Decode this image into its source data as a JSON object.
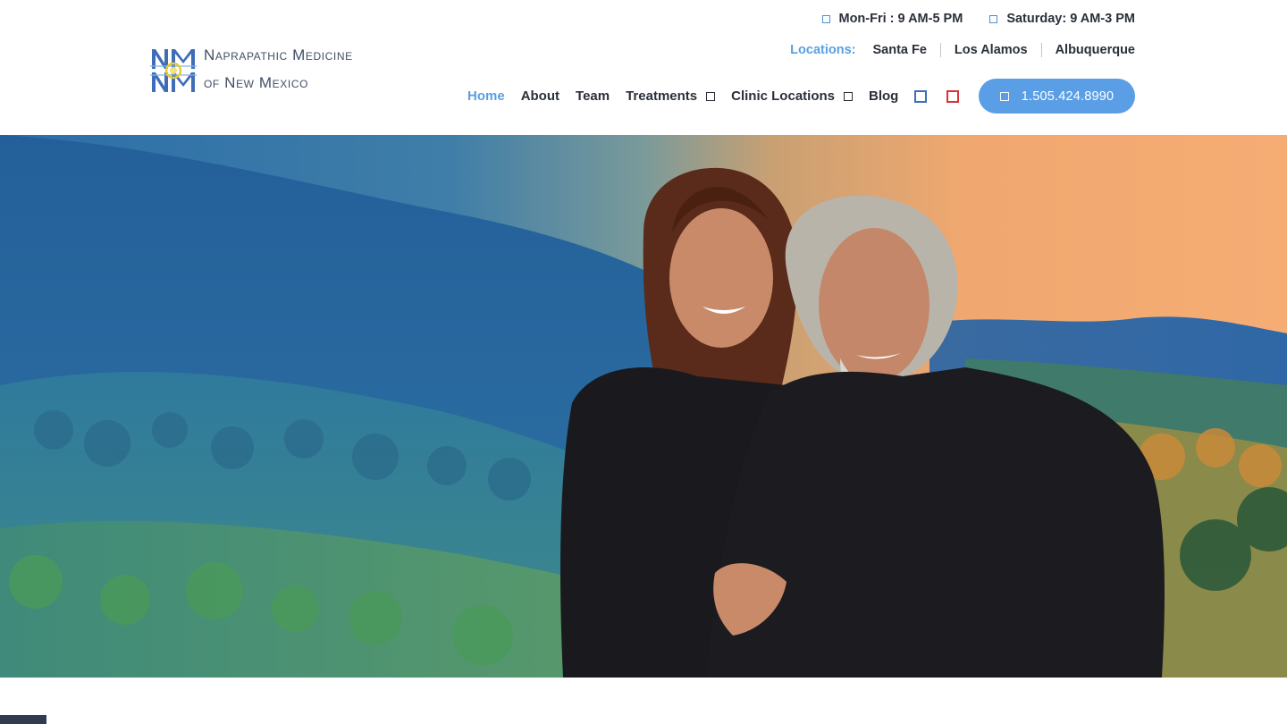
{
  "brand": {
    "name_line1": "Naprapathic Medicine",
    "name_line2": "of New Mexico",
    "colors": {
      "accent": "#5aa0e0",
      "button": "#5a9ee6",
      "text": "#2a2f3a",
      "logo_text": "#3f4f66"
    }
  },
  "hours": [
    {
      "icon": "square-icon",
      "text": "Mon-Fri : 9 AM-5 PM"
    },
    {
      "icon": "square-icon",
      "text": "Saturday: 9 AM-3 PM"
    }
  ],
  "locations": {
    "label": "Locations:",
    "items": [
      "Santa Fe",
      "Los Alamos",
      "Albuquerque"
    ]
  },
  "nav": {
    "items": [
      {
        "label": "Home",
        "active": true,
        "dropdown": false
      },
      {
        "label": "About",
        "active": false,
        "dropdown": false
      },
      {
        "label": "Team",
        "active": false,
        "dropdown": false
      },
      {
        "label": "Treatments",
        "active": false,
        "dropdown": true
      },
      {
        "label": "Clinic Locations",
        "active": false,
        "dropdown": true
      },
      {
        "label": "Blog",
        "active": false,
        "dropdown": false
      }
    ],
    "social_icons": [
      "facebook-icon",
      "youtube-icon"
    ],
    "phone": "1.505.424.8990"
  },
  "hero": {
    "image": "couple-portrait-mountain-landscape"
  }
}
